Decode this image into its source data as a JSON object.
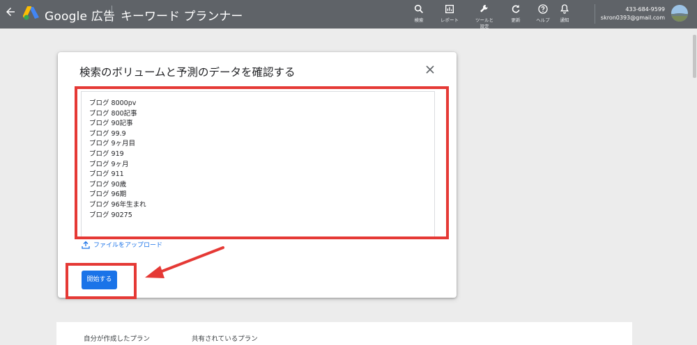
{
  "header": {
    "brand": "Google 広告",
    "page_title": "キーワード プランナー",
    "tools": [
      {
        "icon": "search-icon",
        "label": "検索"
      },
      {
        "icon": "reports-icon",
        "label": "レポート"
      },
      {
        "icon": "wrench-icon",
        "label": "ツールと\n設定"
      },
      {
        "icon": "refresh-icon",
        "label": "更新"
      },
      {
        "icon": "help-icon",
        "label": "ヘルプ"
      },
      {
        "icon": "bell-icon",
        "label": "通知"
      }
    ],
    "account_id": "433-684-9599",
    "account_email": "skron0393@gmail.com"
  },
  "dialog": {
    "title": "検索のボリュームと予測のデータを確認する",
    "keywords": [
      "ブログ 8000pv",
      "ブログ 800記事",
      "ブログ 90記事",
      "ブログ 99.9",
      "ブログ 9ヶ月目",
      "ブログ 919",
      "ブログ 9ヶ月",
      "ブログ 911",
      "ブログ 90歳",
      "ブログ 96期",
      "ブログ 96年生まれ",
      "ブログ 90275"
    ],
    "upload_label": "ファイルをアップロード",
    "start_label": "開始する"
  },
  "plans": {
    "tabs": [
      "自分が作成したプラン",
      "共有されているプラン"
    ]
  },
  "colors": {
    "topbar": "#5f6368",
    "accent": "#1a73e8",
    "annotation": "#e53935"
  }
}
